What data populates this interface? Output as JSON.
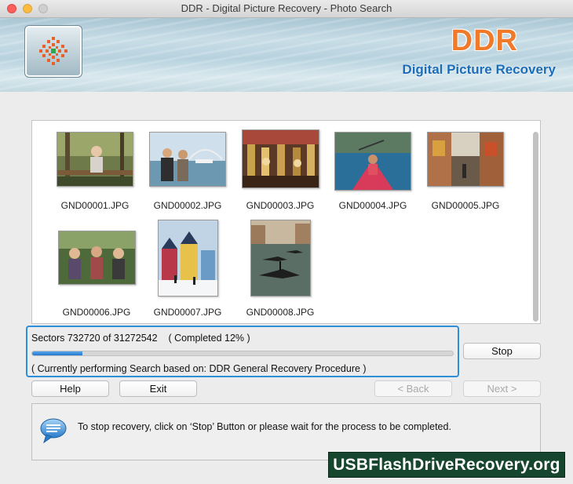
{
  "window": {
    "title": "DDR - Digital Picture Recovery - Photo Search"
  },
  "banner": {
    "brand": "DDR",
    "subtitle": "Digital Picture Recovery"
  },
  "gallery": {
    "items": [
      {
        "name": "GND00001.JPG"
      },
      {
        "name": "GND00002.JPG"
      },
      {
        "name": "GND00003.JPG"
      },
      {
        "name": "GND00004.JPG"
      },
      {
        "name": "GND00005.JPG"
      },
      {
        "name": "GND00006.JPG"
      },
      {
        "name": "GND00007.JPG"
      },
      {
        "name": "GND00008.JPG"
      }
    ]
  },
  "progress": {
    "sectors_text": "Sectors 732720 of 31272542    ( Completed 12% )",
    "percent": 12,
    "procedure_text": "( Currently performing Search based on: DDR General Recovery Procedure )"
  },
  "buttons": {
    "stop": "Stop",
    "help": "Help",
    "exit": "Exit",
    "back": "< Back",
    "next": "Next >"
  },
  "info": {
    "message": "To stop recovery, click on ‘Stop’ Button or please wait for the process to be completed."
  },
  "watermark": {
    "text": "USBFlashDriveRecovery.org"
  },
  "colors": {
    "accent": "#2d8fd9",
    "brand_orange": "#f07a2a",
    "brand_blue": "#1b6db8",
    "watermark_bg": "#17462f"
  }
}
